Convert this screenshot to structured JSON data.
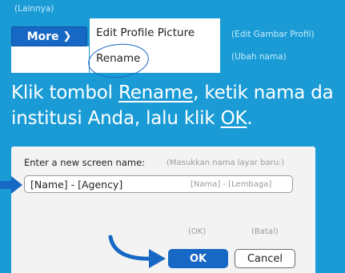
{
  "menu": {
    "more_annotation": "(Lainnya)",
    "more_label": "More",
    "edit_picture_label": "Edit Profile Picture",
    "edit_picture_annotation": "(Edit Gambar Profil)",
    "rename_label": "Rename",
    "rename_annotation": "(Ubah nama)"
  },
  "instruction": {
    "line1_prefix": "Klik tombol ",
    "line1_link": "Rename",
    "line1_suffix": ", ketik nama da",
    "line2_prefix": "institusi Anda, lalu klik ",
    "line2_link": "OK",
    "line2_suffix": "."
  },
  "dialog": {
    "prompt_label": "Enter a new screen name:",
    "prompt_annotation": "(Masukkan nama layar baru:)",
    "input_value": "[Name] - [Agency]",
    "input_annotation": "[Nama] - [Lembaga]",
    "ok_annotation": "(OK)",
    "cancel_annotation": "(Batal)",
    "ok_label": "OK",
    "cancel_label": "Cancel"
  },
  "colors": {
    "background": "#1a9bd6",
    "accent_blue": "#1668c4",
    "dialog_bg": "#f3f3f3"
  }
}
